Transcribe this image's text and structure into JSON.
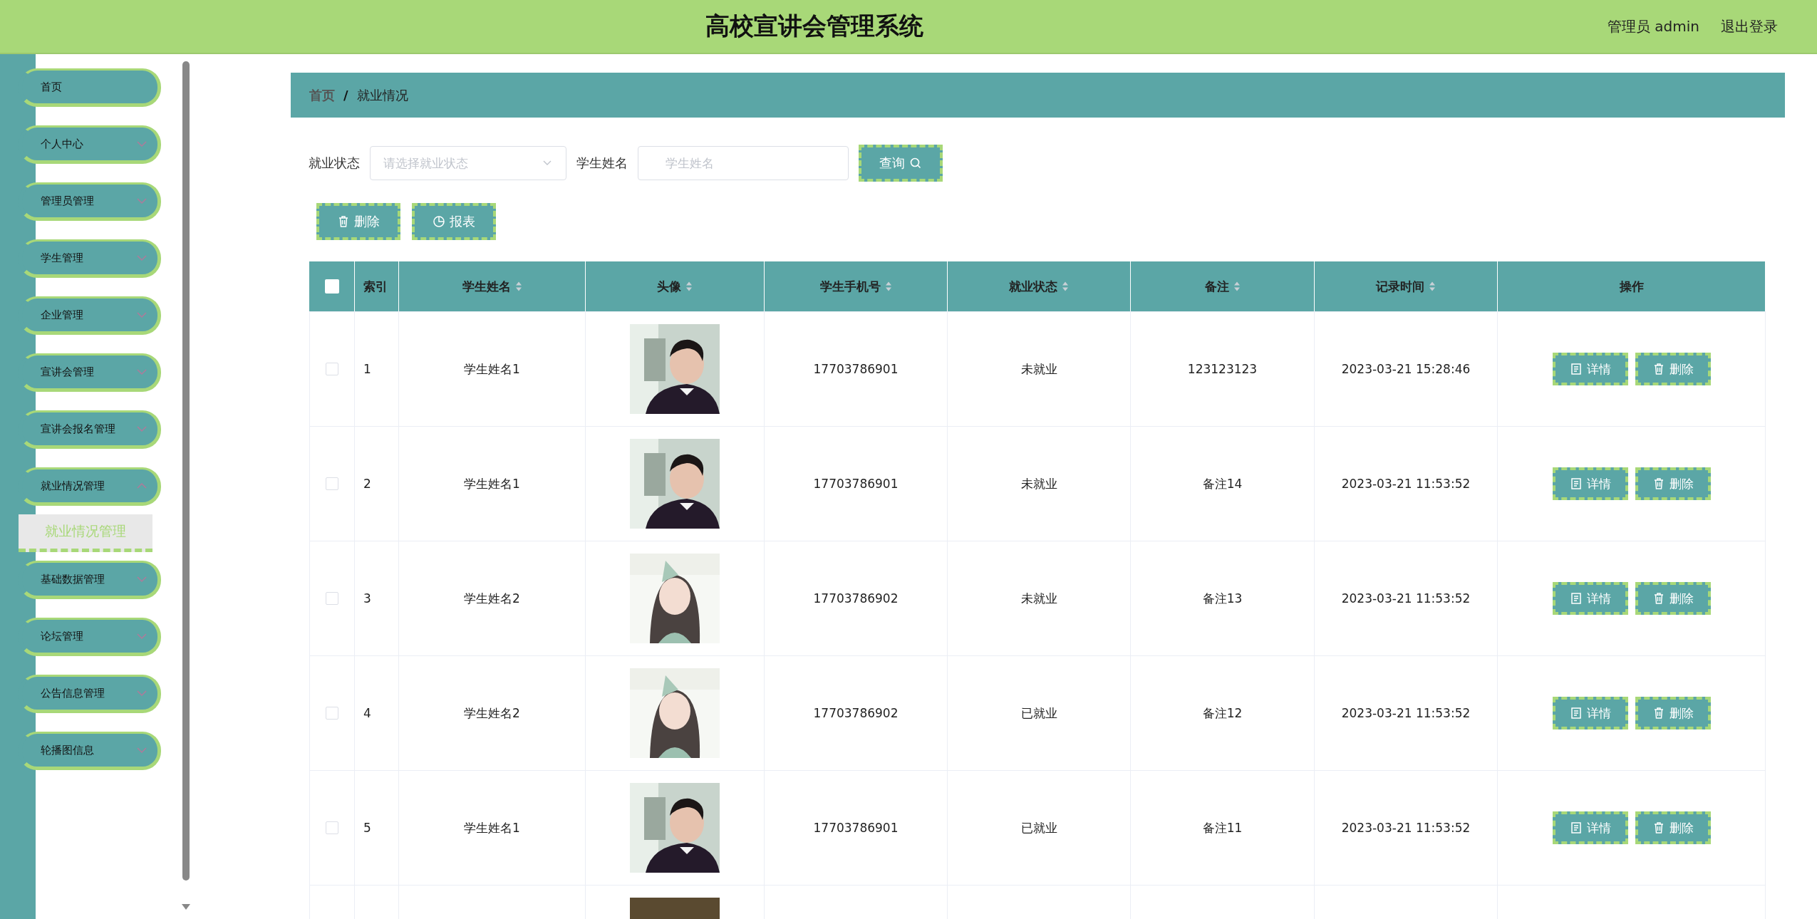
{
  "header": {
    "title": "高校宣讲会管理系统",
    "user": "管理员 admin",
    "logout": "退出登录"
  },
  "menu": [
    {
      "kind": "link",
      "label": "首页"
    },
    {
      "kind": "group",
      "label": "个人中心",
      "expanded": false
    },
    {
      "kind": "group",
      "label": "管理员管理",
      "expanded": false
    },
    {
      "kind": "group",
      "label": "学生管理",
      "expanded": false
    },
    {
      "kind": "group",
      "label": "企业管理",
      "expanded": false
    },
    {
      "kind": "group",
      "label": "宣讲会管理",
      "expanded": false
    },
    {
      "kind": "group",
      "label": "宣讲会报名管理",
      "expanded": false
    },
    {
      "kind": "group",
      "label": "就业情况管理",
      "expanded": true,
      "children": [
        {
          "label": "就业情况管理",
          "selected": true
        }
      ]
    },
    {
      "kind": "group",
      "label": "基础数据管理",
      "expanded": false
    },
    {
      "kind": "group",
      "label": "论坛管理",
      "expanded": false
    },
    {
      "kind": "group",
      "label": "公告信息管理",
      "expanded": false
    },
    {
      "kind": "group",
      "label": "轮播图信息",
      "expanded": false
    }
  ],
  "breadcrumb": {
    "items": [
      "首页",
      "就业情况"
    ],
    "separator": "/"
  },
  "filters": [
    {
      "kind": "select",
      "label": "就业状态",
      "placeholder": "请选择就业状态"
    },
    {
      "kind": "input",
      "label": "学生姓名",
      "placeholder": "学生姓名"
    }
  ],
  "search_button": "查询",
  "actions": [
    {
      "kind": "delete",
      "label": "删除"
    },
    {
      "kind": "report",
      "label": "报表"
    }
  ],
  "table": {
    "select_all": {
      "checked": false
    },
    "columns": [
      {
        "label": "索引",
        "sortable": false
      },
      {
        "label": "学生姓名",
        "sortable": true
      },
      {
        "label": "头像",
        "sortable": true
      },
      {
        "label": "学生手机号",
        "sortable": true
      },
      {
        "label": "就业状态",
        "sortable": true
      },
      {
        "label": "备注",
        "sortable": true
      },
      {
        "label": "记录时间",
        "sortable": true
      },
      {
        "label": "操作",
        "sortable": false
      }
    ],
    "rows": [
      {
        "checked": false,
        "index": "1",
        "name": "学生姓名1",
        "avatar": {
          "kind": "picture"
        },
        "phone": "17703786901",
        "status": "未就业",
        "note": "123123123",
        "time": "2023-03-21 15:28:46",
        "buttons": [
          {
            "kind": "detail",
            "label": "详情"
          },
          {
            "kind": "delete",
            "label": "删除"
          }
        ]
      },
      {
        "checked": false,
        "index": "2",
        "name": "学生姓名1",
        "avatar": {
          "kind": "picture"
        },
        "phone": "17703786901",
        "status": "未就业",
        "note": "备注14",
        "time": "2023-03-21 11:53:52",
        "buttons": [
          {
            "kind": "detail",
            "label": "详情"
          },
          {
            "kind": "delete",
            "label": "删除"
          }
        ]
      },
      {
        "checked": false,
        "index": "3",
        "name": "学生姓名2",
        "avatar": {
          "kind": "picture"
        },
        "phone": "17703786902",
        "status": "未就业",
        "note": "备注13",
        "time": "2023-03-21 11:53:52",
        "buttons": [
          {
            "kind": "detail",
            "label": "详情"
          },
          {
            "kind": "delete",
            "label": "删除"
          }
        ]
      },
      {
        "checked": false,
        "index": "4",
        "name": "学生姓名2",
        "avatar": {
          "kind": "picture"
        },
        "phone": "17703786902",
        "status": "已就业",
        "note": "备注12",
        "time": "2023-03-21 11:53:52",
        "buttons": [
          {
            "kind": "detail",
            "label": "详情"
          },
          {
            "kind": "delete",
            "label": "删除"
          }
        ]
      },
      {
        "checked": false,
        "index": "5",
        "name": "学生姓名1",
        "avatar": {
          "kind": "picture"
        },
        "phone": "17703786901",
        "status": "已就业",
        "note": "备注11",
        "time": "2023-03-21 11:53:52",
        "buttons": [
          {
            "kind": "detail",
            "label": "详情"
          },
          {
            "kind": "delete",
            "label": "删除"
          }
        ]
      },
      {
        "avatar": {
          "kind": "picture"
        }
      }
    ]
  }
}
